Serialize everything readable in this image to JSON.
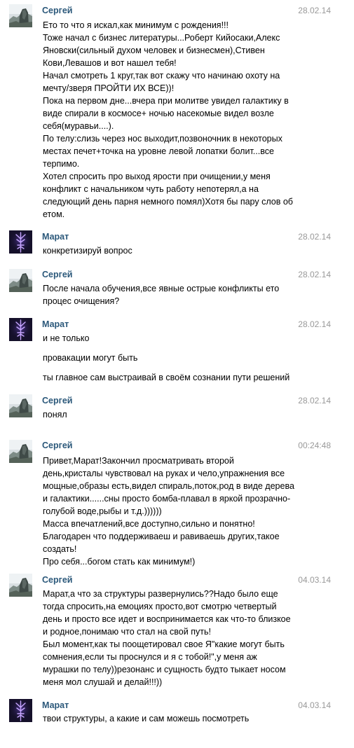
{
  "icons": {
    "sergey_avatar": "rock-landscape-avatar",
    "marat_avatar": "purple-trident-symbol-avatar"
  },
  "colors": {
    "author": "#2b587a",
    "date": "#999999",
    "text": "#000000",
    "marat_avatar_bg": "#15102a",
    "marat_avatar_glyph": "#c7a6ff"
  },
  "messages": [
    {
      "author": "Сергей",
      "date": "28.02.14",
      "text": "Ето то что я искал,как минимум с рождения!!!\nТоже начал с бизнес литературы...Роберт Кийосаки,Алекс Яновски(сильный духом человек и бизнесмен),Стивен Кови,Левашов и вот нашел тебя!\nНачал смотреть 1 круг,так вот скажу что начинаю охоту на мечту/зверя ПРОЙТИ ИХ ВСЕ))!\nПока на первом дне...вчера при молитве увидел галактику в виде спирали в космосе+ ночью насекомые видел возле себя(муравьи....).\nПо телу:слизь через нос выходит,позвоночник в некоторых местах печет+точка на уровне левой лопатки болит...все терпимо.\nХотел спросить про выход ярости при очищении,у меня конфликт с начальником чуть работу непотерял,а на следующий день парня немного помял)Хотя бы пару слов об етом."
    },
    {
      "author": "Марат",
      "date": "28.02.14",
      "text": "конкретизируй вопрос"
    },
    {
      "author": "Сергей",
      "date": "28.02.14",
      "text": "После начала обучения,все явные острые конфликты ето процес очищения?"
    },
    {
      "author": "Марат",
      "date": "28.02.14",
      "text": "и не только",
      "extra": [
        "провакации могут быть",
        "ты главное сам выстраивай в своём сознании пути решений"
      ]
    },
    {
      "author": "Сергей",
      "date": "28.02.14",
      "text": "понял"
    },
    {
      "author": "Сергей",
      "date": "00:24:48",
      "text": "Привет,Марат!Закончил просматривать второй день,кристалы чувствовал на руках и чело,упражнения все мощные,образы есть,видел спираль,поток,род в виде дерева и галактики......сны просто бомба-плавал в яркой прозрачно-голубой воде,рыбы и т.д.))))))\nМасса впечатлений,все доступно,сильно и понятно!\nБлагодарен что поддерживаеш и равиваешь других,такое создать!\nПро себя...богом стать как минимум!)"
    },
    {
      "author": "Сергей",
      "date": "04.03.14",
      "text": "Марат,а что за структуры развернулись??Надо было еще тогда спросить,на емоциях просто,вот смотрю четвертый день и просто все идет и воспринимается как что-то близкое и родное,понимаю что стал на свой путь!\nБыл момент,как ты поощетировал свое Я\"какие могут быть сомнения,если ты проснулся и я с тобой!\",у меня аж мурашки по телу))резонанс и сущность будто тыкает носом меня мол слушай и делай!!!))"
    },
    {
      "author": "Марат",
      "date": "04.03.14",
      "text": "твои структуры, а какие и сам можешь посмотреть"
    }
  ]
}
